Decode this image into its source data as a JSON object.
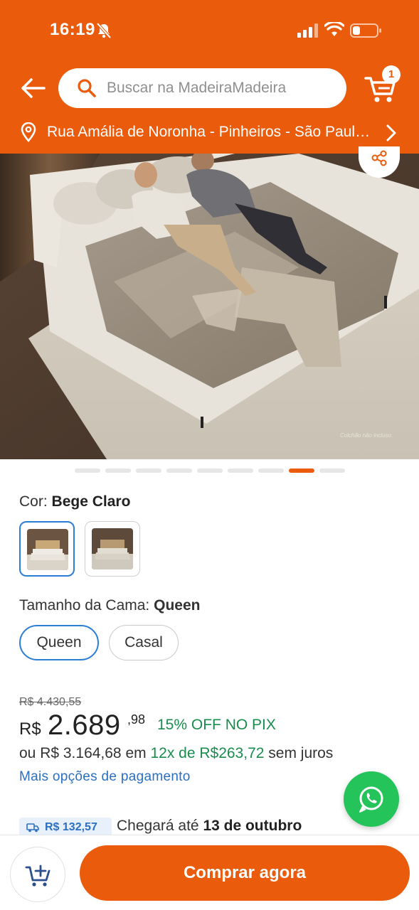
{
  "status_bar": {
    "time": "16:19"
  },
  "header": {
    "search_placeholder": "Buscar na MadeiraMadeira",
    "cart_count": "1",
    "location": "Rua Amália de Noronha - Pinheiros - São Paulo - SP"
  },
  "hero": {
    "image_note": "Colchão não incluso.",
    "carousel_total": 9,
    "carousel_active": 8
  },
  "color": {
    "label": "Cor:",
    "value": "Bege Claro"
  },
  "size": {
    "label": "Tamanho da Cama:",
    "value": "Queen",
    "options": [
      "Queen",
      "Casal"
    ]
  },
  "price": {
    "old": "R$ 4.430,55",
    "currency": "R$",
    "main": "2.689",
    "cents": ",98",
    "pix": "15% OFF NO PIX",
    "install_prefix": "ou R$ 3.164,68 em",
    "install_highlight": "12x de R$263,72",
    "install_suffix": "sem juros",
    "more_payment": "Mais opções de pagamento"
  },
  "shipping": {
    "price": "R$ 132,57",
    "text_prefix": "Chegará até",
    "date": "13 de outubro"
  },
  "bottom": {
    "buy_label": "Comprar agora"
  },
  "colors": {
    "brand": "#ea5b0c",
    "selected_border": "#2b7ed6",
    "pix_green": "#1a8c4e",
    "link_blue": "#2b6fc2",
    "whatsapp": "#25c45a"
  }
}
